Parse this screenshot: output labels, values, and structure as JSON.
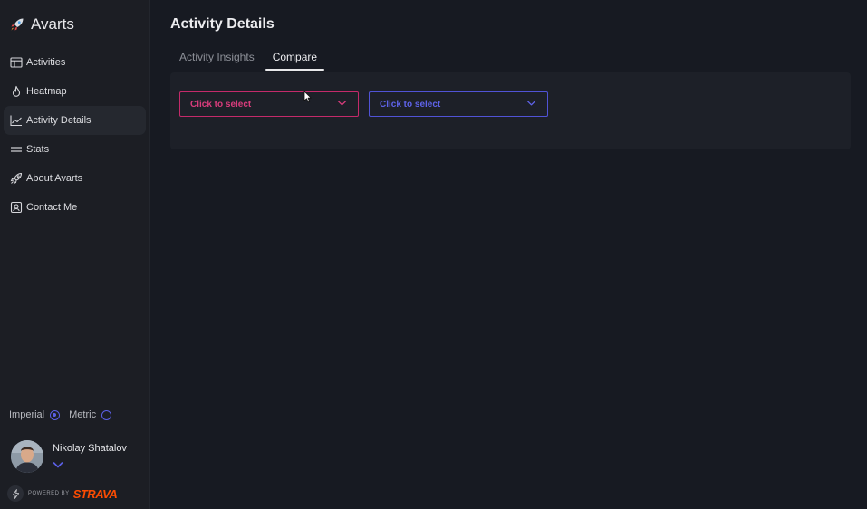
{
  "brand": {
    "name": "Avarts"
  },
  "sidebar": {
    "items": [
      {
        "label": "Activities",
        "icon": "table-icon"
      },
      {
        "label": "Heatmap",
        "icon": "flame-icon"
      },
      {
        "label": "Activity Details",
        "icon": "chart-line-icon",
        "active": true
      },
      {
        "label": "Stats",
        "icon": "lines-icon"
      },
      {
        "label": "About Avarts",
        "icon": "rocket-icon"
      },
      {
        "label": "Contact Me",
        "icon": "contact-badge-icon"
      }
    ]
  },
  "units": {
    "imperial_label": "Imperial",
    "metric_label": "Metric",
    "selected": "Imperial"
  },
  "user": {
    "name": "Nikolay Shatalov"
  },
  "footer": {
    "powered_by": "POWERED BY",
    "brand": "STRAVA"
  },
  "main": {
    "title": "Activity Details",
    "tabs": [
      {
        "label": "Activity Insights",
        "active": false
      },
      {
        "label": "Compare",
        "active": true
      }
    ],
    "compare": {
      "select_a": {
        "placeholder": "Click to select"
      },
      "select_b": {
        "placeholder": "Click to select"
      }
    }
  },
  "colors": {
    "accent_pink": "#d93c7c",
    "accent_blue": "#5f63ea",
    "strava": "#fc4c02"
  }
}
